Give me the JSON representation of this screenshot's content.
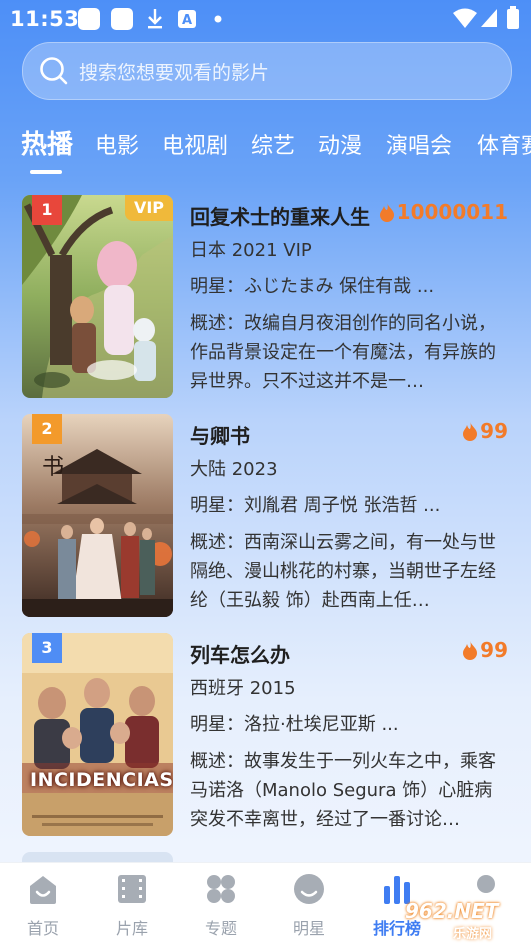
{
  "status_bar": {
    "time": "11:53"
  },
  "search": {
    "placeholder": "搜索您想要观看的影片"
  },
  "tabs": [
    {
      "label": "热播",
      "active": true
    },
    {
      "label": "电影"
    },
    {
      "label": "电视剧"
    },
    {
      "label": "综艺"
    },
    {
      "label": "动漫"
    },
    {
      "label": "演唱会"
    },
    {
      "label": "体育赛"
    }
  ],
  "items": [
    {
      "rank": "1",
      "badge": "VIP",
      "title": "回复术士的重来人生",
      "heat": "10000011",
      "meta": "日本 2021 VIP",
      "stars": "明星：ふじたまみ 保住有哉 ...",
      "desc": "概述：改编自月夜泪创作的同名小说，作品背景设定在一个有魔法，有异族的异世界。只不过这并不是一…"
    },
    {
      "rank": "2",
      "badge": "",
      "title": "与卿书",
      "heat": "99",
      "meta": "大陆 2023",
      "stars": "明星：刘胤君 周子悦 张浩哲 ...",
      "desc": "概述：西南深山云雾之间，有一处与世隔绝、漫山桃花的村寨，当朝世子左经纶（王弘毅 饰）赴西南上任…"
    },
    {
      "rank": "3",
      "badge": "",
      "title": "列车怎么办",
      "heat": "99",
      "meta": "西班牙 2015",
      "stars": "明星：洛拉·杜埃尼亚斯 ...",
      "desc": "概述：故事发生于一列火车之中，乘客马诺洛（Manolo Segura 饰）心脏病突发不幸离世，经过了一番讨论…"
    }
  ],
  "nav": [
    {
      "label": "首页",
      "icon": "home-icon"
    },
    {
      "label": "片库",
      "icon": "film-icon"
    },
    {
      "label": "专题",
      "icon": "grid-icon"
    },
    {
      "label": "明星",
      "icon": "face-icon"
    },
    {
      "label": "排行榜",
      "icon": "chart-icon",
      "active": true
    },
    {
      "label": "",
      "icon": "profile-icon"
    }
  ],
  "poster3_text": "INCIDENCIAS",
  "watermark": "962.NET",
  "watermark_sub": "乐游网",
  "colors": {
    "accent": "#3f7df2",
    "heat": "#f27b2a",
    "vip": "#f0b93a",
    "rank1": "#e8473b",
    "rank2": "#f39a2b",
    "rank3": "#4f8df5"
  }
}
